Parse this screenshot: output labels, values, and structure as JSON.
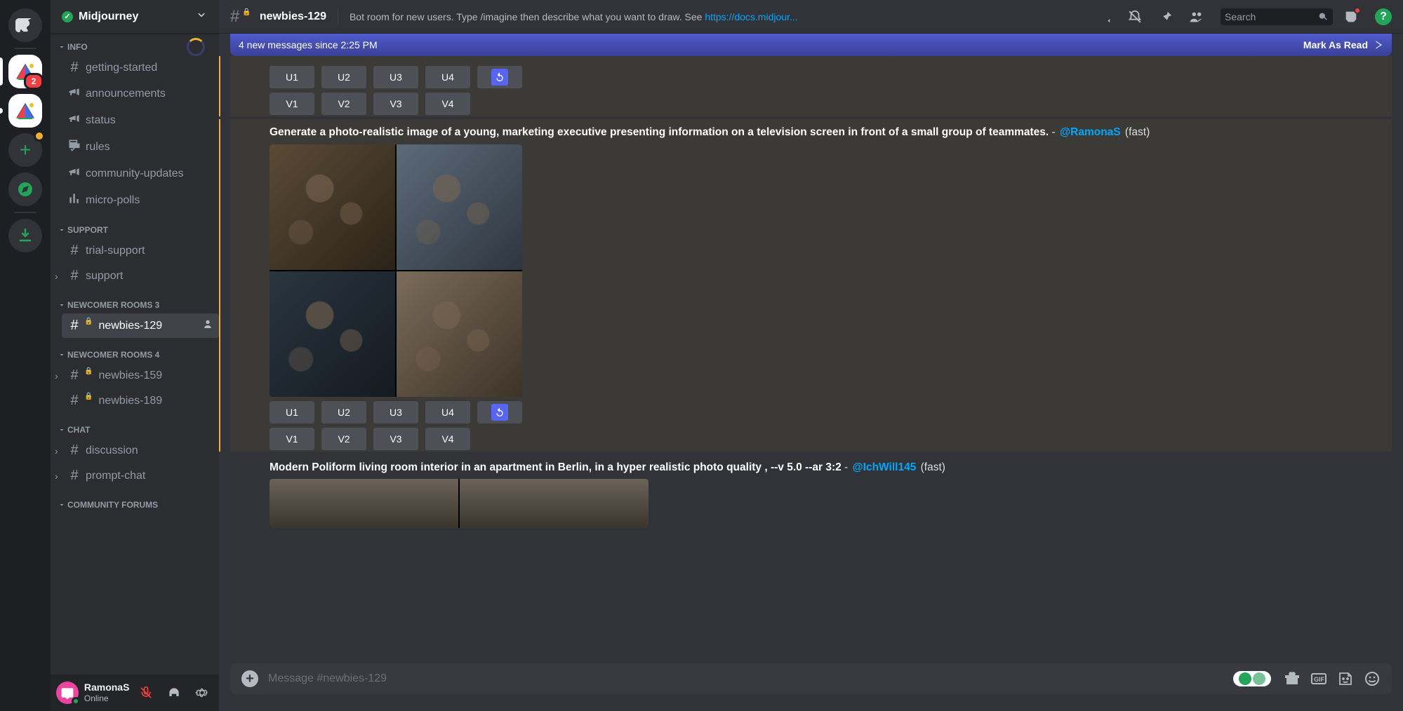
{
  "server_rail": {
    "home_tooltip": "Direct Messages",
    "servers": [
      {
        "id": "midjourney-1",
        "indicator": "tall",
        "badge": "2"
      },
      {
        "id": "midjourney-2",
        "indicator": "short",
        "badge": null
      }
    ],
    "add_label": "+",
    "compass_label": "Explore",
    "download_label": "Download Apps"
  },
  "server_header": {
    "name": "Midjourney"
  },
  "categories": [
    {
      "name": "INFO",
      "channels": [
        {
          "icon": "hash",
          "label": "getting-started"
        },
        {
          "icon": "megaphone",
          "label": "announcements"
        },
        {
          "icon": "megaphone",
          "label": "status"
        },
        {
          "icon": "check",
          "label": "rules"
        },
        {
          "icon": "megaphone",
          "label": "community-updates"
        },
        {
          "icon": "bar",
          "label": "micro-polls"
        }
      ]
    },
    {
      "name": "SUPPORT",
      "channels": [
        {
          "icon": "hash",
          "label": "trial-support"
        },
        {
          "icon": "hash",
          "label": "support",
          "thread": true
        }
      ]
    },
    {
      "name": "NEWCOMER ROOMS 3",
      "channels": [
        {
          "icon": "hash",
          "label": "newbies-129",
          "active": true,
          "people": true,
          "lock": true
        }
      ]
    },
    {
      "name": "NEWCOMER ROOMS 4",
      "channels": [
        {
          "icon": "hash",
          "label": "newbies-159",
          "thread": true,
          "lock": true
        },
        {
          "icon": "hash",
          "label": "newbies-189",
          "lock": true
        }
      ]
    },
    {
      "name": "CHAT",
      "channels": [
        {
          "icon": "hash",
          "label": "discussion",
          "thread": true
        },
        {
          "icon": "hash",
          "label": "prompt-chat",
          "thread": true
        }
      ]
    },
    {
      "name": "COMMUNITY FORUMS",
      "channels": []
    }
  ],
  "user_panel": {
    "username": "RamonaS",
    "status": "Online"
  },
  "chat_header": {
    "channel": "newbies-129",
    "topic_prefix": "Bot room for new users. Type /imagine then describe what you want to draw. See ",
    "topic_link": "https://docs.midjour...",
    "search_placeholder": "Search"
  },
  "new_msgs_bar": {
    "text": "4 new messages since 2:25 PM",
    "mark": "Mark As Read"
  },
  "messages": {
    "msg1": {
      "urow": [
        "U1",
        "U2",
        "U3",
        "U4"
      ],
      "vrow": [
        "V1",
        "V2",
        "V3",
        "V4"
      ]
    },
    "msg2": {
      "prompt": "Generate a photo-realistic image of a young, marketing executive presenting information on a television screen in front of a small group of teammates.",
      "sep": " - ",
      "mention": "@RamonaS",
      "suffix": " (fast)",
      "urow": [
        "U1",
        "U2",
        "U3",
        "U4"
      ],
      "vrow": [
        "V1",
        "V2",
        "V3",
        "V4"
      ]
    },
    "msg3": {
      "prompt": "Modern Poliform living room interior in an apartment in Berlin, in a hyper realistic photo quality , --v 5.0 --ar 3:2",
      "sep": " - ",
      "mention": "@IchWill145",
      "suffix": " (fast)"
    }
  },
  "composer": {
    "placeholder": "Message #newbies-129"
  }
}
